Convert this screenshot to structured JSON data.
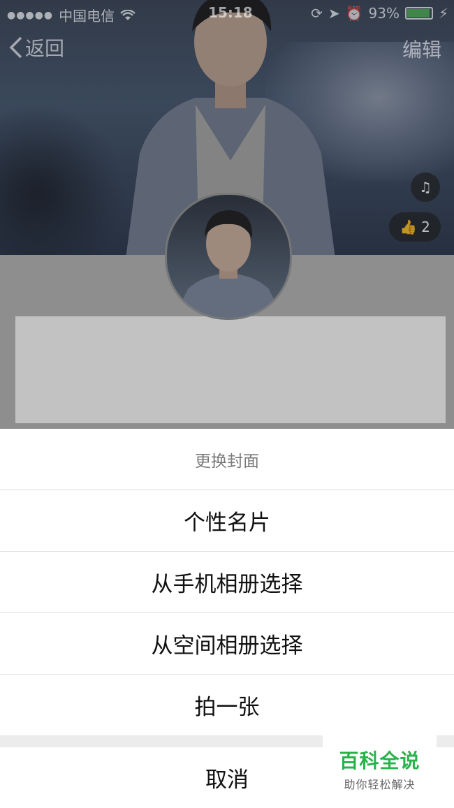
{
  "status_bar": {
    "signal_dots": "●●●●●",
    "carrier": "中国电信",
    "wifi_icon": "wifi-icon",
    "time": "15:18",
    "battery_percent": "93%",
    "battery_level": 0.93
  },
  "nav": {
    "back_label": "返回",
    "edit_label": "编辑"
  },
  "cover": {
    "like_count": "2"
  },
  "sheet": {
    "title": "更换封面",
    "items": [
      {
        "label": "个性名片"
      },
      {
        "label": "从手机相册选择"
      },
      {
        "label": "从空间相册选择"
      },
      {
        "label": "拍一张"
      }
    ],
    "cancel_label": "取消"
  },
  "watermark": {
    "title": "百科全说",
    "subtitle": "助你轻松解决"
  },
  "colors": {
    "sheet_bg": "#ffffff",
    "separator": "#dedede",
    "watermark_green": "#28b34a",
    "card_gray": "#c2c2c2"
  }
}
